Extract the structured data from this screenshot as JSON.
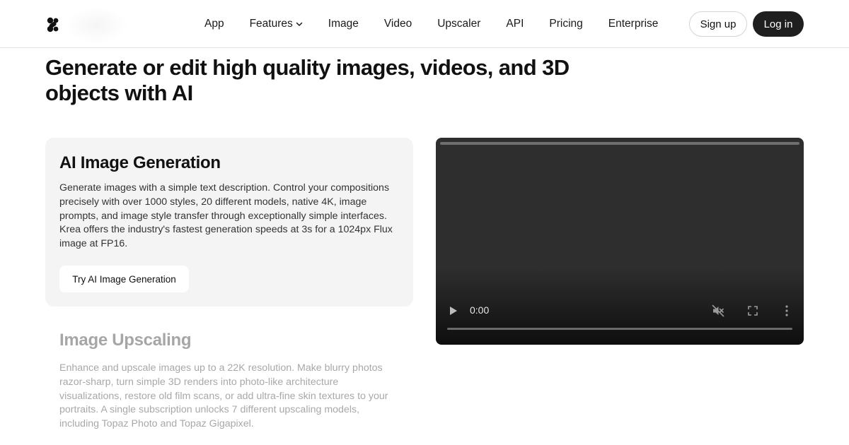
{
  "nav": {
    "items": [
      {
        "label": "App"
      },
      {
        "label": "Features"
      },
      {
        "label": "Image"
      },
      {
        "label": "Video"
      },
      {
        "label": "Upscaler"
      },
      {
        "label": "API"
      },
      {
        "label": "Pricing"
      },
      {
        "label": "Enterprise"
      }
    ],
    "signup_label": "Sign up",
    "login_label": "Log in"
  },
  "hero": {
    "headline": "Generate or edit high quality images, videos, and 3D objects with AI"
  },
  "features": [
    {
      "title": "AI Image Generation",
      "description": "Generate images with a simple text description. Control your compositions precisely with over 1000 styles, 20 different models, native 4K, image prompts, and image style transfer through exceptionally simple interfaces. Krea offers the industry's fastest generation speeds at 3s for a 1024px Flux image at FP16.",
      "cta": "Try AI Image Generation"
    },
    {
      "title": "Image Upscaling",
      "description": "Enhance and upscale images up to a 22K resolution. Make blurry photos razor-sharp, turn simple 3D renders into photo-like architecture visualizations, restore old film scans, or add ultra-fine skin textures to your portraits. A single subscription unlocks 7 different upscaling models, including Topaz Photo and Topaz Gigapixel."
    }
  ],
  "video": {
    "time": "0:00",
    "progress": 0
  },
  "colors": {
    "login_bg": "#1f1f1f",
    "card_bg": "#f4f4f4",
    "muted_text": "#a8a8a8"
  },
  "icons": [
    "krea-logo-icon",
    "chevron-down-icon",
    "play-icon",
    "volume-muted-icon",
    "fullscreen-icon",
    "more-vertical-icon"
  ]
}
